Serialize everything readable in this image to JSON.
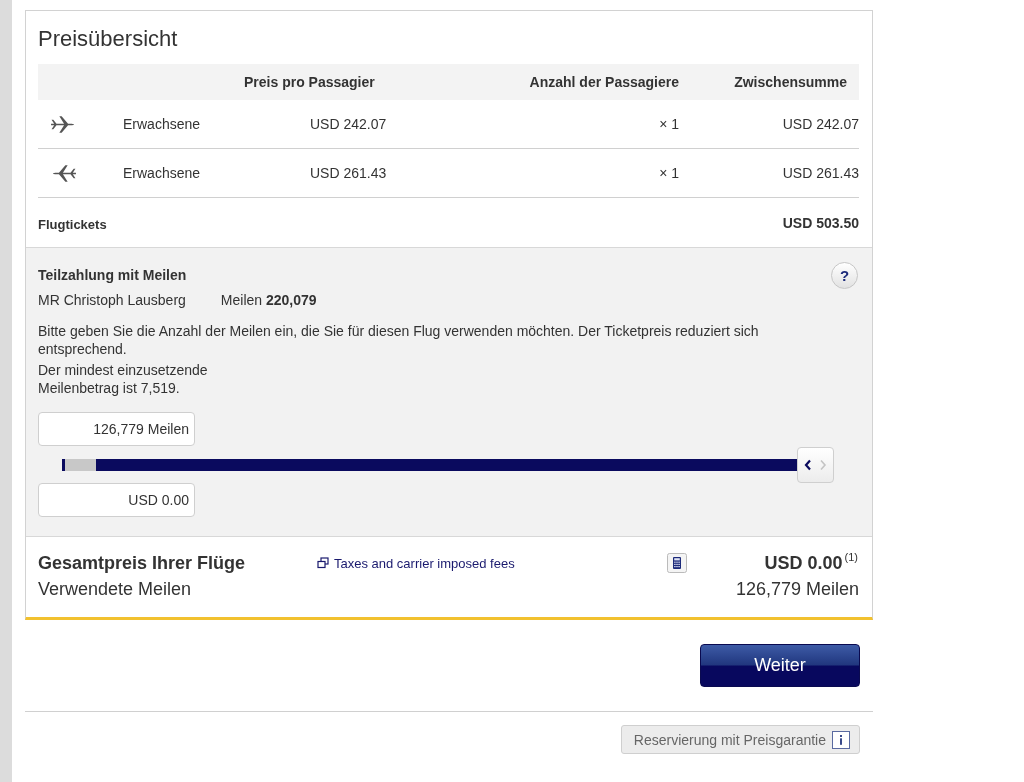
{
  "price_overview": {
    "title": "Preisübersicht",
    "columns": {
      "price": "Preis pro Passagier",
      "count": "Anzahl der Passagiere",
      "subtotal": "Zwischensumme"
    },
    "rows": [
      {
        "kind": "outbound",
        "passenger_type": "Erwachsene",
        "price": "USD 242.07",
        "count": "× 1",
        "subtotal": "USD 242.07"
      },
      {
        "kind": "return",
        "passenger_type": "Erwachsene",
        "price": "USD 261.43",
        "count": "× 1",
        "subtotal": "USD 261.43"
      }
    ],
    "total": {
      "label": "Flugtickets",
      "value": "USD 503.50"
    }
  },
  "miles_payment": {
    "title": "Teilzahlung mit Meilen",
    "help_button": "?",
    "member_name": "MR Christoph Lausberg",
    "miles_balance": "Meilen **220,079**",
    "instructions": "Bitte geben Sie die Anzahl der Meilen ein, die Sie für diesen Flug verwenden möchten. Der Ticketpreis reduziert sich entsprechend.",
    "minimum_note": "Der mindest einzusetzende Meilenbetrag ist 7,519.",
    "miles_field": {
      "value": "126,779 Meilen"
    },
    "slider": {
      "level": 1.0,
      "decrease_enabled": true,
      "increase_enabled": false
    },
    "amount_field": {
      "value": "USD 0.00"
    }
  },
  "summary": {
    "total_label": "Gesamtpreis Ihrer Flüge",
    "miles_label": "Verwendete Meilen",
    "fees_link": "Taxes and carrier imposed fees",
    "total_price": "USD 0.00",
    "footnote_mark": "(1)",
    "miles_used": "126,779 Meilen"
  },
  "continue_button": "Weiter",
  "price_guarantee_button": "Reservierung mit Preisgarantie"
}
